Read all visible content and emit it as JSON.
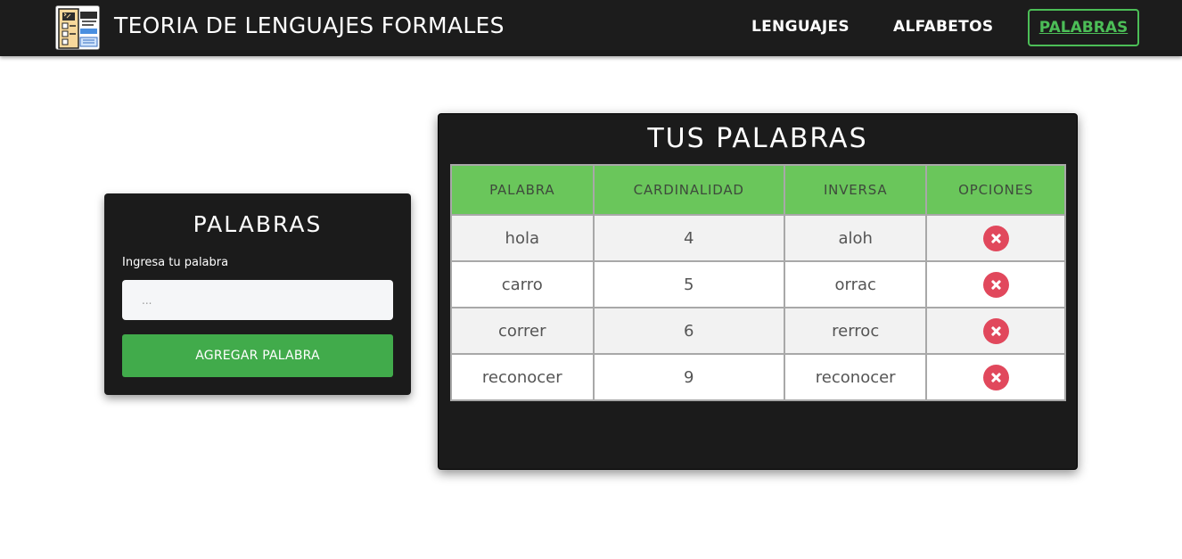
{
  "navbar": {
    "brand": "TEORIA DE LENGUAJES FORMALES",
    "links": [
      "LENGUAJES",
      "ALFABETOS"
    ],
    "active_link": "PALABRAS"
  },
  "form": {
    "title": "PALABRAS",
    "label": "Ingresa tu palabra",
    "placeholder": "...",
    "button_label": "AGREGAR PALABRA"
  },
  "table": {
    "title": "TUS PALABRAS",
    "headers": [
      "PALABRA",
      "CARDINALIDAD",
      "INVERSA",
      "OPCIONES"
    ],
    "rows": [
      {
        "palabra": "hola",
        "cardinalidad": "4",
        "inversa": "aloh"
      },
      {
        "palabra": "carro",
        "cardinalidad": "5",
        "inversa": "orrac"
      },
      {
        "palabra": "correr",
        "cardinalidad": "6",
        "inversa": "rerroc"
      },
      {
        "palabra": "reconocer",
        "cardinalidad": "9",
        "inversa": "reconocer"
      }
    ]
  },
  "colors": {
    "navbar_bg": "#1c1c1c",
    "accent_green": "#4cbe57",
    "header_green": "#6ac65b",
    "button_green": "#41ab4b",
    "delete_red": "#e1485c"
  },
  "icons": {
    "logo": "code-document-icon",
    "delete": "close-circle-icon"
  }
}
